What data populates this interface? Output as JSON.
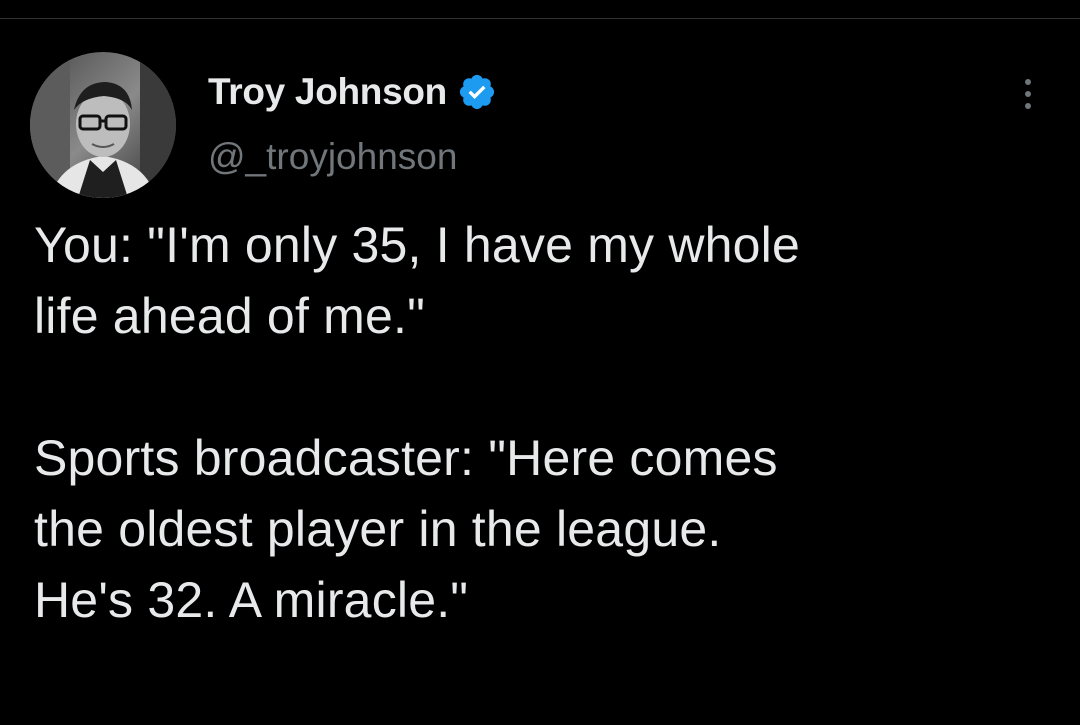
{
  "author": {
    "display_name": "Troy Johnson",
    "handle": "@_troyjohnson",
    "verified": true,
    "verified_color": "#1d9bf0"
  },
  "icons": {
    "verified": "verified-check-badge-icon",
    "more": "more-options-icon",
    "avatar": "profile-photo"
  },
  "tweet": {
    "paragraph_1": [
      "You: \"I'm only 35, I have my whole",
      "life ahead of me.\""
    ],
    "paragraph_2": [
      "Sports broadcaster: \"Here comes",
      "the oldest player in the league.",
      "He's 32. A miracle.\""
    ]
  },
  "colors": {
    "background": "#000000",
    "text_primary": "#e7e9ea",
    "text_secondary": "#71767b"
  }
}
